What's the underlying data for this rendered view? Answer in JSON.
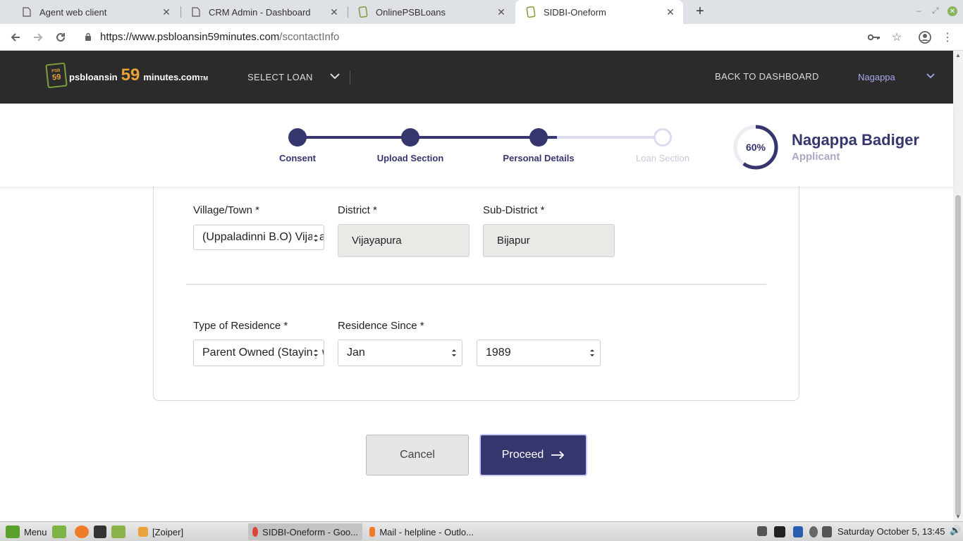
{
  "browser": {
    "tabs": [
      {
        "title": "Agent web client",
        "icon": "page-icon",
        "active": false
      },
      {
        "title": "CRM Admin - Dashboard",
        "icon": "page-icon",
        "active": false
      },
      {
        "title": "OnlinePSBLoans",
        "icon": "site-favicon",
        "active": false
      },
      {
        "title": "SIDBI-Oneform",
        "icon": "site-favicon",
        "active": true
      }
    ],
    "url_host": "https://www.psbloansin59minutes.com",
    "url_path": "/scontactInfo"
  },
  "header": {
    "logo_badge_top": "PSB",
    "logo_badge_num": "59",
    "logo_prefix": "psbloansin",
    "logo_big": "59",
    "logo_suffix": "minutes.com",
    "logo_tm": "TM",
    "select_loan": "SELECT LOAN",
    "back_to_dashboard": "BACK TO DASHBOARD",
    "user_name": "Nagappa"
  },
  "stepper": {
    "steps": [
      {
        "label": "Consent",
        "done": true
      },
      {
        "label": "Upload Section",
        "done": true
      },
      {
        "label": "Personal Details",
        "done": true
      },
      {
        "label": "Loan Section",
        "done": false
      }
    ],
    "progress_percent": 60,
    "progress_label": "60%",
    "applicant_name": "Nagappa Badiger",
    "applicant_role": "Applicant"
  },
  "form": {
    "village_label": "Village/Town *",
    "village_value": "(Uppaladinni B.O) Vijayapura",
    "district_label": "District *",
    "district_value": "Vijayapura",
    "subdistrict_label": "Sub-District *",
    "subdistrict_value": "Bijapur",
    "residence_type_label": "Type of Residence *",
    "residence_type_value": "Parent Owned (Staying with Parents)",
    "residence_since_label": "Residence Since *",
    "residence_month_value": "Jan",
    "residence_year_value": "1989"
  },
  "actions": {
    "cancel": "Cancel",
    "proceed": "Proceed"
  },
  "colors": {
    "primary": "#36366f",
    "header_bg": "#2b2b2b",
    "logo_accent": "#e8a33a",
    "pending_step": "#dcdcf0"
  },
  "taskbar": {
    "menu": "Menu",
    "items": [
      {
        "label": "[Zoiper]",
        "active": false
      },
      {
        "label": "SIDBI-Oneform - Goo...",
        "active": true
      },
      {
        "label": "Mail - helpline - Outlo...",
        "active": false
      }
    ],
    "clock": "Saturday October  5, 13:45"
  }
}
